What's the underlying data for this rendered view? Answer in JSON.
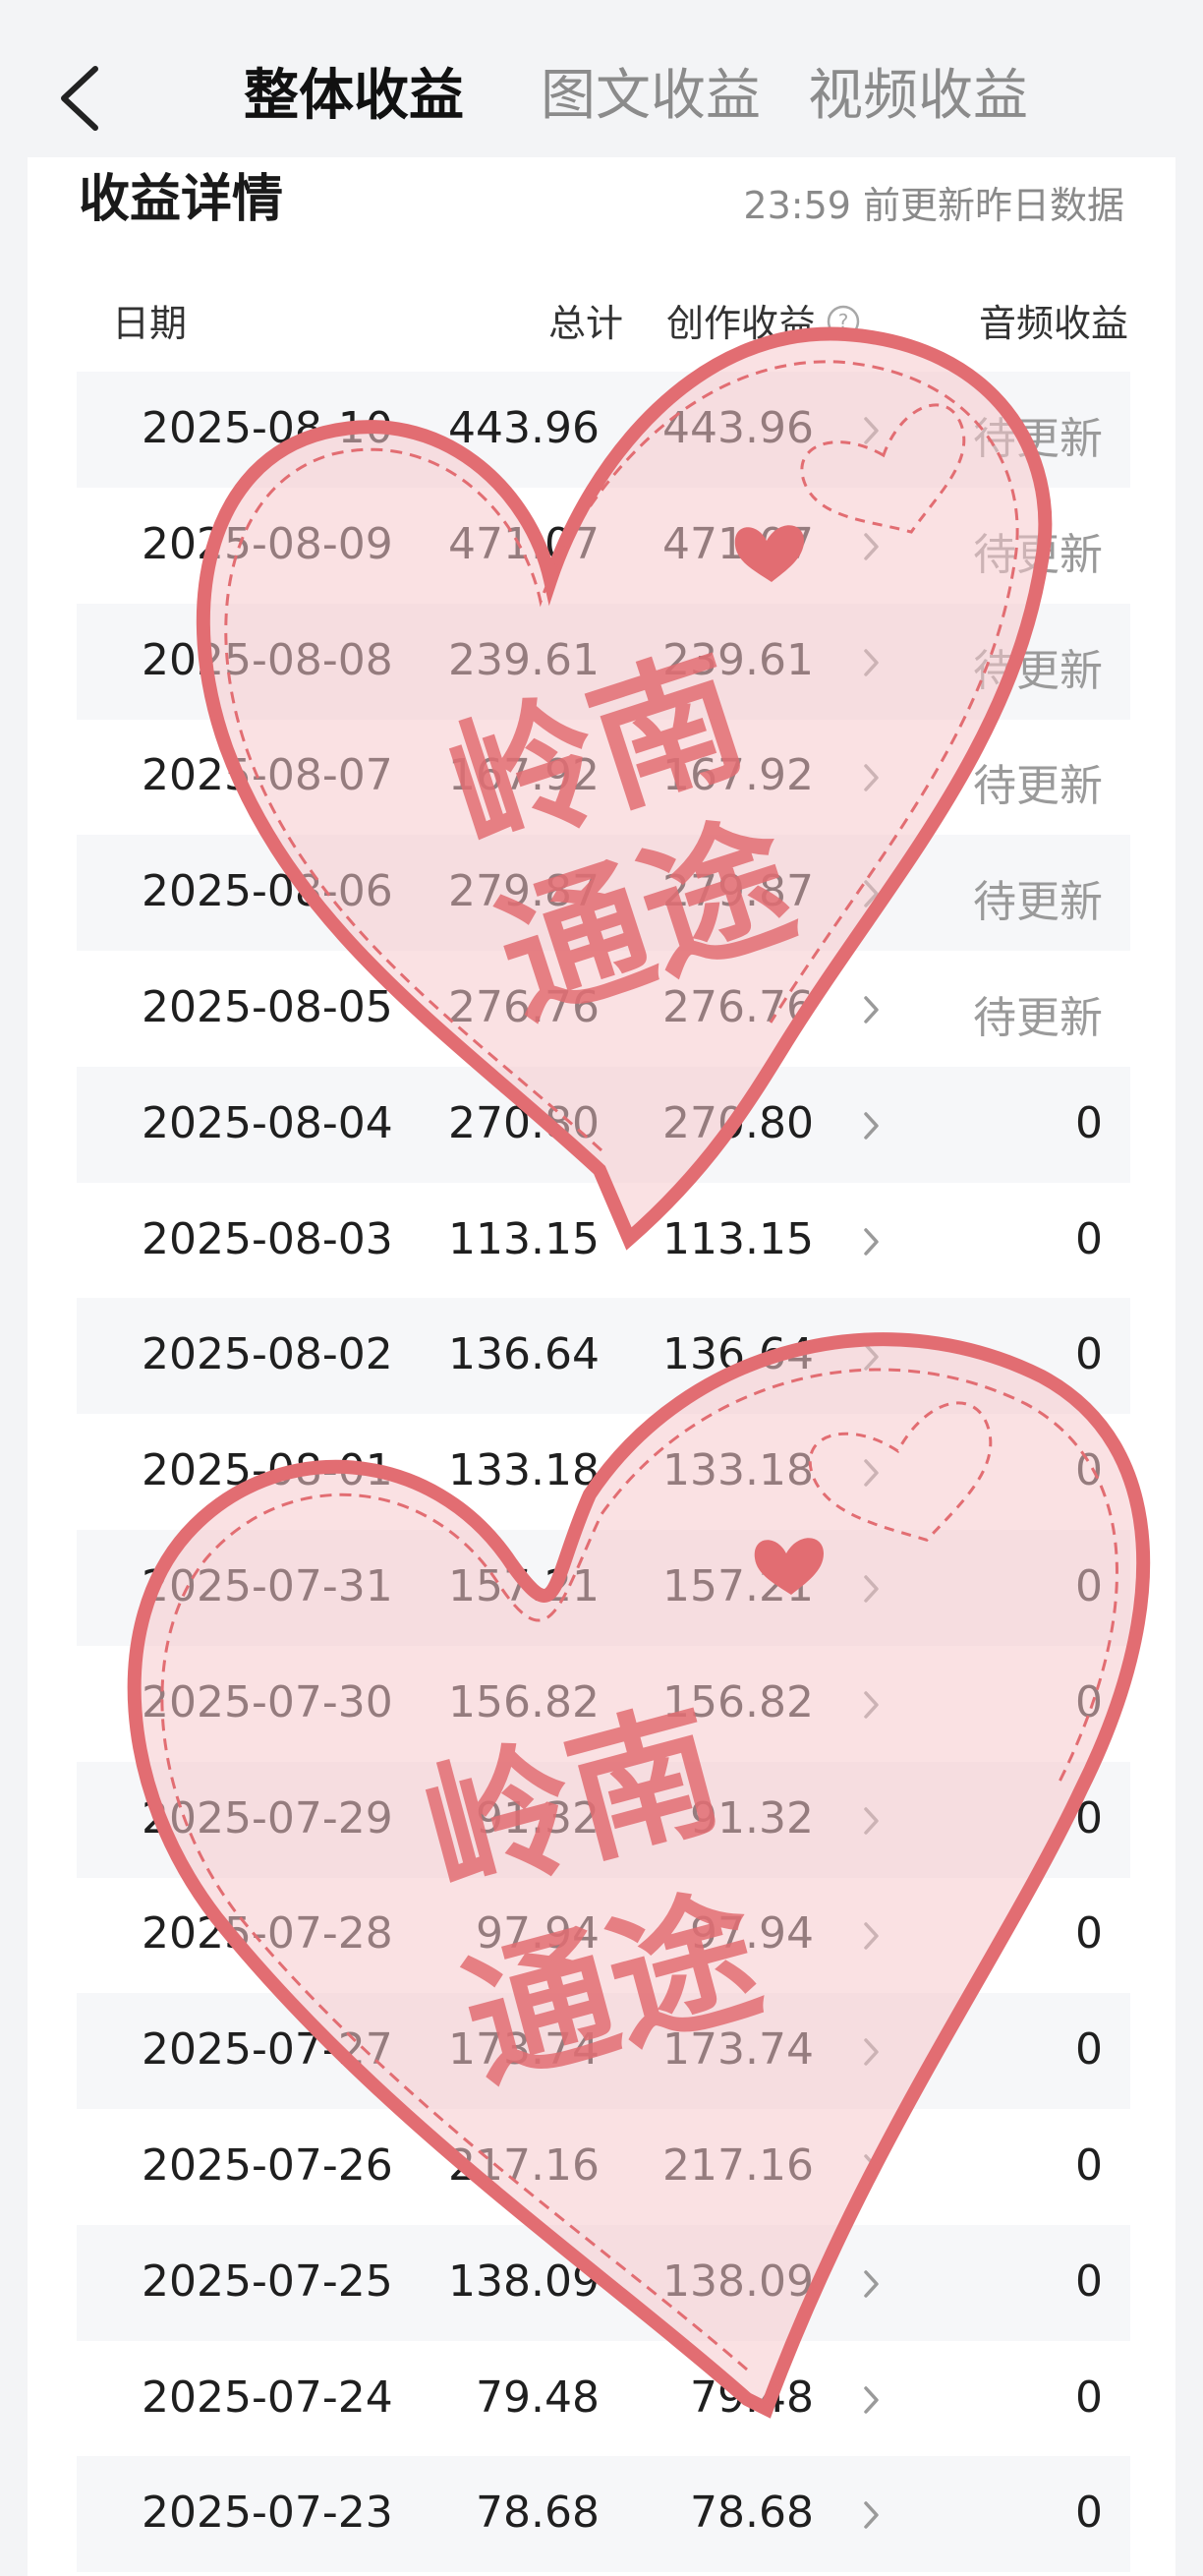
{
  "header": {
    "tabs": [
      {
        "label": "整体收益",
        "active": true
      },
      {
        "label": "图文收益",
        "active": false
      },
      {
        "label": "视频收益",
        "active": false
      }
    ]
  },
  "section": {
    "title": "收益详情",
    "update_note": "23:59 前更新昨日数据"
  },
  "table": {
    "columns": [
      "日期",
      "总计",
      "创作收益",
      "音频收益"
    ],
    "rows": [
      {
        "date": "2025-08-10",
        "total": "443.96",
        "creation": "443.96",
        "audio": "待更新"
      },
      {
        "date": "2025-08-09",
        "total": "471.07",
        "creation": "471.07",
        "audio": "待更新"
      },
      {
        "date": "2025-08-08",
        "total": "239.61",
        "creation": "239.61",
        "audio": "待更新"
      },
      {
        "date": "2025-08-07",
        "total": "167.92",
        "creation": "167.92",
        "audio": "待更新"
      },
      {
        "date": "2025-08-06",
        "total": "279.87",
        "creation": "279.87",
        "audio": "待更新"
      },
      {
        "date": "2025-08-05",
        "total": "276.76",
        "creation": "276.76",
        "audio": "待更新"
      },
      {
        "date": "2025-08-04",
        "total": "270.80",
        "creation": "270.80",
        "audio": "0"
      },
      {
        "date": "2025-08-03",
        "total": "113.15",
        "creation": "113.15",
        "audio": "0"
      },
      {
        "date": "2025-08-02",
        "total": "136.64",
        "creation": "136.64",
        "audio": "0"
      },
      {
        "date": "2025-08-01",
        "total": "133.18",
        "creation": "133.18",
        "audio": "0"
      },
      {
        "date": "2025-07-31",
        "total": "157.21",
        "creation": "157.21",
        "audio": "0"
      },
      {
        "date": "2025-07-30",
        "total": "156.82",
        "creation": "156.82",
        "audio": "0"
      },
      {
        "date": "2025-07-29",
        "total": "91.32",
        "creation": "91.32",
        "audio": "0"
      },
      {
        "date": "2025-07-28",
        "total": "97.94",
        "creation": "97.94",
        "audio": "0"
      },
      {
        "date": "2025-07-27",
        "total": "173.74",
        "creation": "173.74",
        "audio": "0"
      },
      {
        "date": "2025-07-26",
        "total": "217.16",
        "creation": "217.16",
        "audio": "0"
      },
      {
        "date": "2025-07-25",
        "total": "138.09",
        "creation": "138.09",
        "audio": "0"
      },
      {
        "date": "2025-07-24",
        "total": "79.48",
        "creation": "79.48",
        "audio": "0"
      },
      {
        "date": "2025-07-23",
        "total": "78.68",
        "creation": "78.68",
        "audio": "0"
      }
    ]
  },
  "watermark": {
    "top": {
      "line1": "岭南",
      "line2": "通途"
    },
    "bottom": {
      "line1": "岭南",
      "line2": "通途"
    }
  },
  "colors": {
    "watermark": "#e26d72",
    "watermark_fill": "#f6c9cc",
    "pending_text": "#9a9a9a"
  },
  "icons": [
    "back-icon",
    "help-icon",
    "chevron-right-icon",
    "heart-watermark"
  ]
}
